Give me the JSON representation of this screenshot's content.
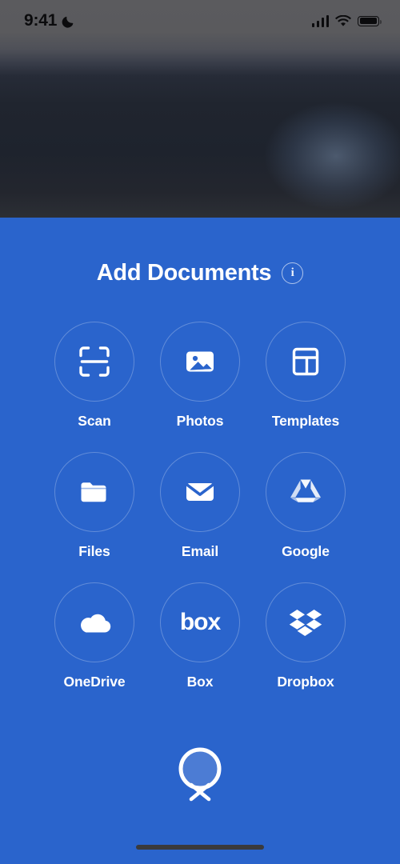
{
  "status_bar": {
    "time": "9:41",
    "dnd_icon": "crescent-moon-icon",
    "signal_icon": "cellular-signal-icon",
    "wifi_icon": "wifi-icon",
    "battery_icon": "battery-full-icon"
  },
  "sheet": {
    "title": "Add Documents",
    "info_label": "i",
    "background_color": "#2a64cc",
    "items": [
      {
        "label": "Scan",
        "icon": "scan-document-icon"
      },
      {
        "label": "Photos",
        "icon": "photos-image-icon"
      },
      {
        "label": "Templates",
        "icon": "templates-layout-icon"
      },
      {
        "label": "Files",
        "icon": "folder-icon"
      },
      {
        "label": "Email",
        "icon": "envelope-icon"
      },
      {
        "label": "Google",
        "icon": "google-drive-icon"
      },
      {
        "label": "OneDrive",
        "icon": "onedrive-cloud-icon"
      },
      {
        "label": "Box",
        "icon": "box-logo-icon"
      },
      {
        "label": "Dropbox",
        "icon": "dropbox-logo-icon"
      }
    ]
  },
  "close_button": {
    "icon": "close-circle-x-icon"
  },
  "home_indicator": {
    "icon": "home-indicator-bar"
  }
}
